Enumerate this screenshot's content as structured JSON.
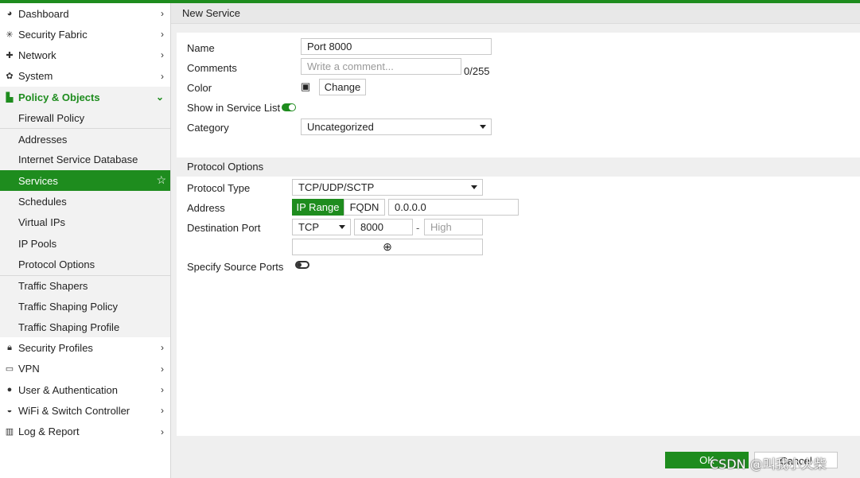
{
  "header": {
    "title": "New Service"
  },
  "sidebar": {
    "items": [
      {
        "label": "Dashboard",
        "icon": "dashboard-icon"
      },
      {
        "label": "Security Fabric",
        "icon": "fabric-icon"
      },
      {
        "label": "Network",
        "icon": "network-icon"
      },
      {
        "label": "System",
        "icon": "gear-icon"
      },
      {
        "label": "Policy & Objects",
        "icon": "policy-icon"
      },
      {
        "label": "Security Profiles",
        "icon": "lock-icon"
      },
      {
        "label": "VPN",
        "icon": "laptop-icon"
      },
      {
        "label": "User & Authentication",
        "icon": "user-icon"
      },
      {
        "label": "WiFi & Switch Controller",
        "icon": "wifi-icon"
      },
      {
        "label": "Log & Report",
        "icon": "chart-icon"
      }
    ],
    "sub_items": [
      "Firewall Policy",
      "Addresses",
      "Internet Service Database",
      "Services",
      "Schedules",
      "Virtual IPs",
      "IP Pools",
      "Protocol Options",
      "Traffic Shapers",
      "Traffic Shaping Policy",
      "Traffic Shaping Profile"
    ]
  },
  "form": {
    "name_label": "Name",
    "name_value": "Port 8000",
    "comments_label": "Comments",
    "comments_placeholder": "Write a comment...",
    "comments_count": "0/255",
    "color_label": "Color",
    "color_change": "Change",
    "show_label": "Show in Service List",
    "show_enabled": true,
    "category_label": "Category",
    "category_value": "Uncategorized"
  },
  "protocol": {
    "section_title": "Protocol Options",
    "type_label": "Protocol Type",
    "type_value": "TCP/UDP/SCTP",
    "address_label": "Address",
    "ip_range": "IP Range",
    "fqdn": "FQDN",
    "address_value": "0.0.0.0",
    "dest_label": "Destination Port",
    "dest_proto": "TCP",
    "dest_low": "8000",
    "dash": "-",
    "dest_high_placeholder": "High",
    "src_label": "Specify Source Ports",
    "src_enabled": false
  },
  "footer": {
    "ok": "OK",
    "cancel": "Cancel"
  },
  "watermark": "CSDN @叫我小火柴",
  "colors": {
    "accent": "#1e8c1e"
  }
}
